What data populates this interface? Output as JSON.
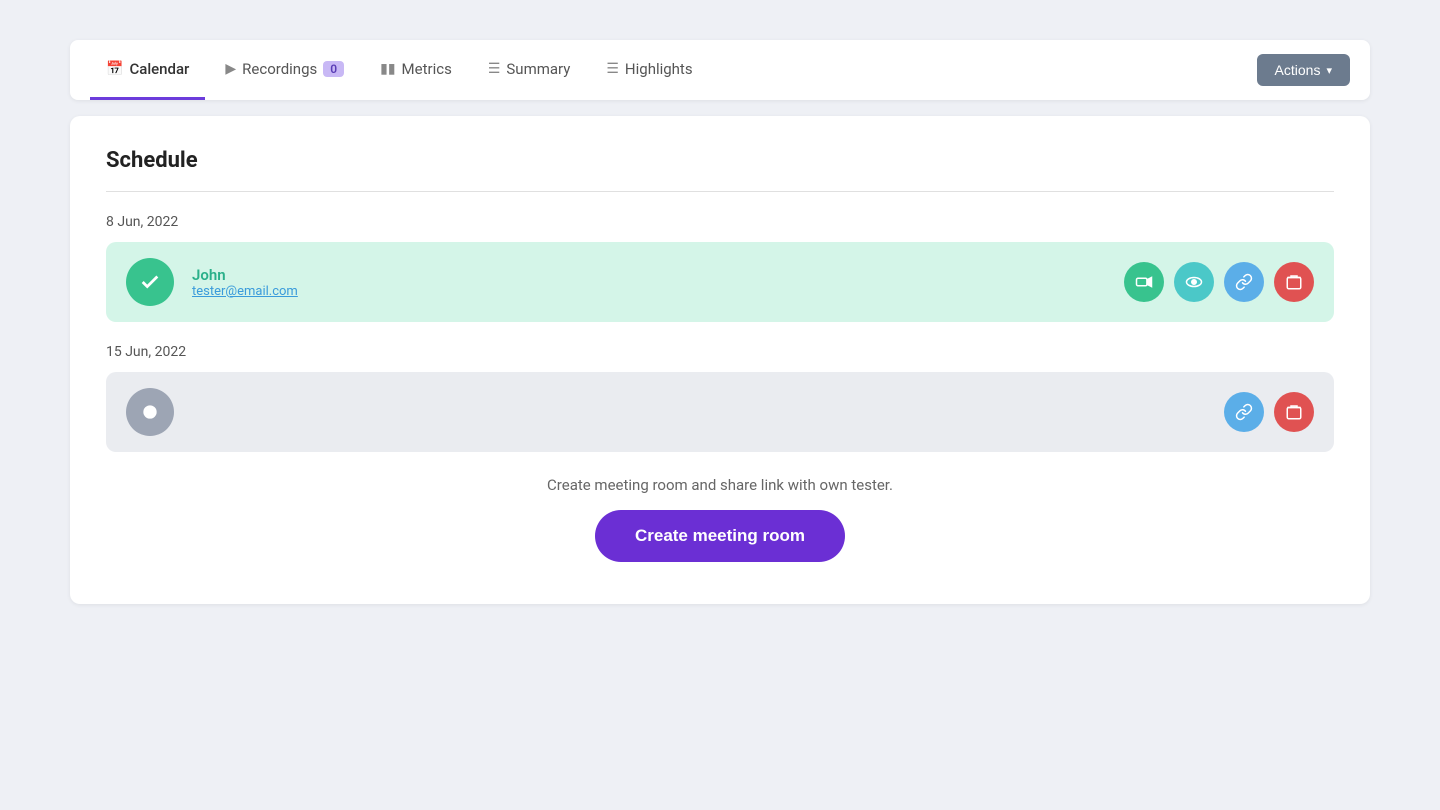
{
  "nav": {
    "tabs": [
      {
        "id": "calendar",
        "label": "Calendar",
        "icon": "📅",
        "active": true,
        "badge": null
      },
      {
        "id": "recordings",
        "label": "Recordings",
        "icon": "🎥",
        "active": false,
        "badge": "0"
      },
      {
        "id": "metrics",
        "label": "Metrics",
        "icon": "📊",
        "active": false,
        "badge": null
      },
      {
        "id": "summary",
        "label": "Summary",
        "icon": "☰",
        "active": false,
        "badge": null
      },
      {
        "id": "highlights",
        "label": "Highlights",
        "icon": "☰",
        "active": false,
        "badge": null
      }
    ],
    "actions_label": "Actions"
  },
  "schedule": {
    "title": "Schedule",
    "dates": [
      {
        "label": "8 Jun, 2022",
        "sessions": [
          {
            "name": "John",
            "email": "tester@email.com",
            "avatar_initial": "✓",
            "theme": "green",
            "actions": [
              "video",
              "eye",
              "link",
              "delete"
            ]
          }
        ]
      },
      {
        "label": "15 Jun, 2022",
        "sessions": [
          {
            "name": "",
            "email": "",
            "avatar_initial": "●",
            "theme": "gray",
            "actions": [
              "link",
              "delete"
            ]
          }
        ]
      }
    ]
  },
  "cta": {
    "description": "Create meeting room and share link with own tester.",
    "button_label": "Create meeting room"
  },
  "icons": {
    "calendar": "&#128197;",
    "recordings": "&#127902;",
    "metrics": "&#128202;",
    "list": "&#9776;",
    "chevron_down": "▾",
    "checkmark": "✓",
    "dot": "●"
  },
  "colors": {
    "active_tab_border": "#6c3cdb",
    "green_avatar": "#38c38e",
    "gray_avatar": "#9da5b4",
    "action_green": "#38c38e",
    "action_teal": "#4bc8c8",
    "action_blue": "#5baee8",
    "action_red": "#e05252",
    "cta_button": "#6b2fd4",
    "session_name_green": "#2ab08a",
    "badge_bg": "#c8b8f5"
  }
}
